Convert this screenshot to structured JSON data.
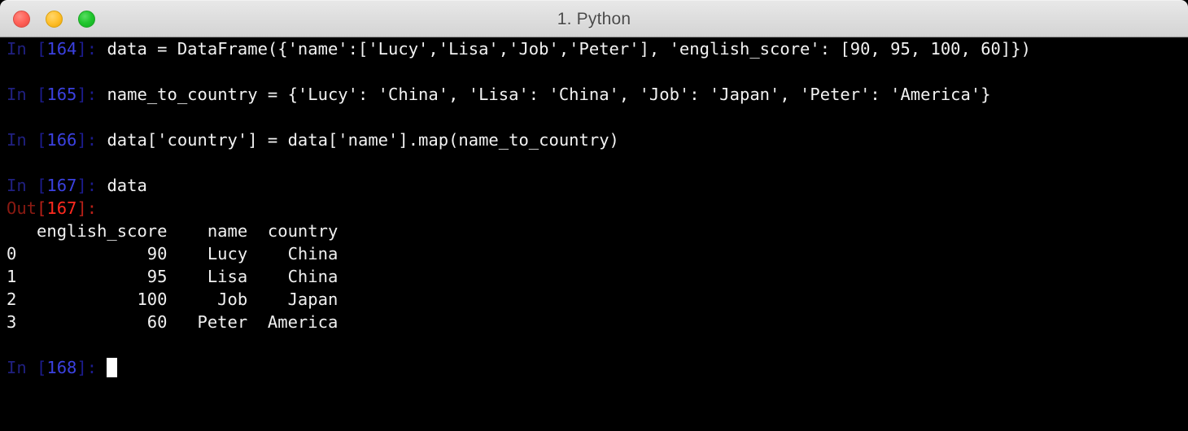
{
  "window": {
    "title": "1. Python",
    "controls": [
      {
        "name": "close",
        "color": "#ff6259"
      },
      {
        "name": "minimize",
        "color": "#ffc130"
      },
      {
        "name": "zoom",
        "color": "#21c62e"
      }
    ]
  },
  "terminal": {
    "colors": {
      "background": "#000000",
      "foreground": "#f2f2f2",
      "in_prompt": "#3b41e0",
      "out_prompt": "#ff2a1f",
      "cursor": "#ffffff"
    },
    "lines": [
      {
        "type": "input",
        "prompt_label": "In",
        "prompt_open": " [",
        "prompt_number": "164",
        "prompt_close": "]: ",
        "code": "data = DataFrame({'name':['Lucy','Lisa','Job','Peter'], 'english_score': [90, 95, 100, 60]})"
      },
      {
        "type": "blank"
      },
      {
        "type": "input",
        "prompt_label": "In",
        "prompt_open": " [",
        "prompt_number": "165",
        "prompt_close": "]: ",
        "code": "name_to_country = {'Lucy': 'China', 'Lisa': 'China', 'Job': 'Japan', 'Peter': 'America'}"
      },
      {
        "type": "blank"
      },
      {
        "type": "input",
        "prompt_label": "In",
        "prompt_open": " [",
        "prompt_number": "166",
        "prompt_close": "]: ",
        "code": "data['country'] = data['name'].map(name_to_country)"
      },
      {
        "type": "blank"
      },
      {
        "type": "input",
        "prompt_label": "In",
        "prompt_open": " [",
        "prompt_number": "167",
        "prompt_close": "]: ",
        "code": "data"
      },
      {
        "type": "output_prompt",
        "prompt_label": "Out",
        "prompt_open": "[",
        "prompt_number": "167",
        "prompt_close": "]:"
      },
      {
        "type": "output",
        "text": "   english_score    name  country"
      },
      {
        "type": "output",
        "text": "0             90    Lucy    China"
      },
      {
        "type": "output",
        "text": "1             95    Lisa    China"
      },
      {
        "type": "output",
        "text": "2            100     Job    Japan"
      },
      {
        "type": "output",
        "text": "3             60   Peter  America"
      },
      {
        "type": "blank"
      },
      {
        "type": "input_active",
        "prompt_label": "In",
        "prompt_open": " [",
        "prompt_number": "168",
        "prompt_close": "]: ",
        "code": ""
      }
    ],
    "dataframe": {
      "index_name": "",
      "columns": [
        "english_score",
        "name",
        "country"
      ],
      "index": [
        "0",
        "1",
        "2",
        "3"
      ],
      "rows": [
        [
          "90",
          "Lucy",
          "China"
        ],
        [
          "95",
          "Lisa",
          "China"
        ],
        [
          "100",
          "Job",
          "Japan"
        ],
        [
          "60",
          "Peter",
          "America"
        ]
      ]
    }
  }
}
